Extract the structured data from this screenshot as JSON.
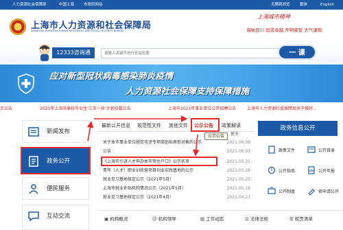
{
  "topbar": {
    "left_items": [
      "人力资源社会保障部",
      "中国上海",
      "市政府网站"
    ],
    "right_items": [
      "无障碍浏览",
      "繁体",
      "English"
    ]
  },
  "header": {
    "title": "上海市人力资源和社会保障局",
    "subtitle": "SHANGHAI MUNICIPAL HUMAN RESOURCES AND SOCIAL SECURITY BUREAU",
    "slogan_title": "上海城市精神",
    "slogan_line": "海纳百川 追求卓越 开明睿智 大气谦和"
  },
  "search": {
    "hotline": "12333咨询通",
    "placeholder": "请输入关键字进行全站检索",
    "button": "一 课"
  },
  "banner": {
    "line1": "应对新型冠状病毒感染肺炎疫情",
    "line2": "人力资源社会保障支持保障措施"
  },
  "ticker": [
    "示公告",
    "2021年上海市高校毕业生'三支一扶'计划招募公告",
    "上海市2021年事业单位公开招聘公告",
    "上海市人力资源社会保障局关于做好..."
  ],
  "nav": [
    {
      "label": "新闻发布",
      "icon": "newspaper-icon"
    },
    {
      "label": "政务公开",
      "icon": "document-icon"
    },
    {
      "label": "便民服务",
      "icon": "people-icon"
    },
    {
      "label": "互动交流",
      "icon": "chat-icon"
    }
  ],
  "tabs": [
    "最新公开信息",
    "规范性文件",
    "其他文件",
    "公示公告",
    "政策解读"
  ],
  "news": [
    {
      "title": "关于本市事业单位脱贫攻坚专项奖励拟表彰对象的公示",
      "date": "2021.06.08"
    },
    {
      "title": "公告",
      "date": "2021.06.03"
    },
    {
      "title": "《上海市引进人才申办本市常住户口》公示名单",
      "date": "2021.05.31"
    },
    {
      "title": "青年（人才）职业训练营项目创业实践基地的公示",
      "date": "2021.05.28"
    },
    {
      "title": "就业见习基地核定公示（2021年5月）",
      "date": "2021.05.25"
    },
    {
      "title": "上海市就业补贴机构情况公示（2021年5月）",
      "date": "2021.05.18"
    },
    {
      "title": "就业见习基地核定公示（2021年4月）",
      "date": "2021.04.27"
    }
  ],
  "more": "更多",
  "tooltip": "公示公告",
  "right_panel": {
    "title": "政务信息公开",
    "items": [
      "政策文件",
      "公开目录",
      "公开指南",
      "公开年报",
      "公开制度",
      "依申请公开"
    ]
  },
  "bottom_bar": [
    "机构概况",
    "机构领导",
    "工作动态",
    "法律法规",
    "权责清单"
  ],
  "colors": {
    "primary": "#1c59a6",
    "highlight": "#e8282a"
  }
}
